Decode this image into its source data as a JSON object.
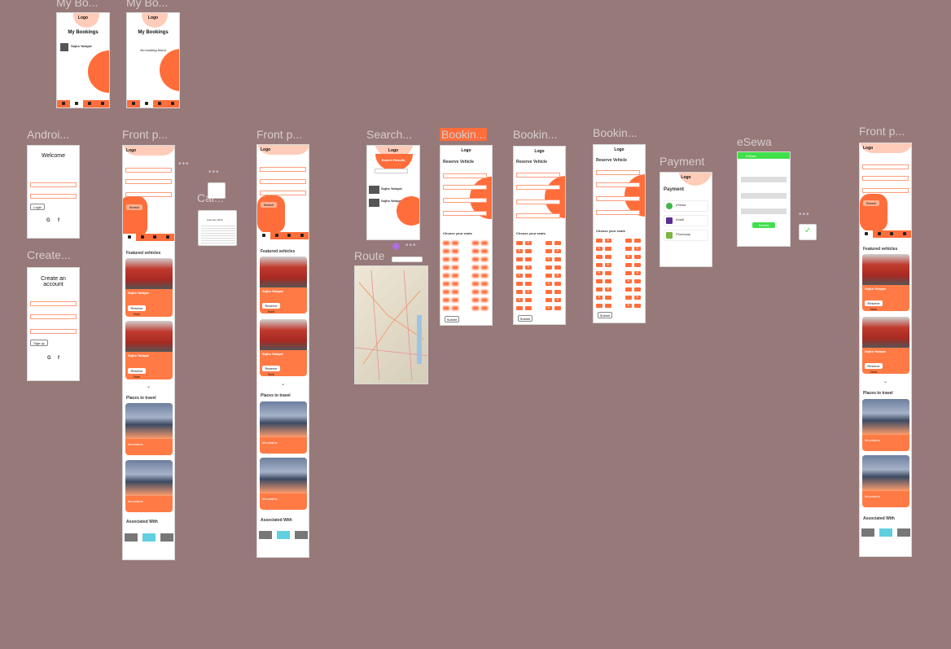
{
  "canvas": {
    "background": "#977979",
    "accent": "#ff6d3b"
  },
  "labels": {
    "my_bookings_1": "My Bo...",
    "my_bookings_2": "My Bo...",
    "android": "Androi...",
    "front_1": "Front p...",
    "front_2": "Front p...",
    "front_3": "Front p...",
    "search": "Search...",
    "booking_1": "Bookin...",
    "booking_2": "Bookin...",
    "booking_3": "Bookin...",
    "payment": "Payment",
    "esewa": "eSewa",
    "create": "Create...",
    "route": "Route",
    "cal": "Cal..."
  },
  "common": {
    "logo": "Logo",
    "featured": "Featured vehicles",
    "places": "Places to travel",
    "associated": "Associated With",
    "bus_name": "Sajha Yatayat",
    "reserve": "Reserve Now",
    "search_btn": "Search",
    "mountain": "Mountains",
    "submit": "Submit",
    "choose_seats": "Choose your seats",
    "reserve_vehicle": "Reserve Vehicle"
  },
  "my_bookings": {
    "title": "My Bookings",
    "item_name": "Sajha Yatayat",
    "empty": "No booking found"
  },
  "welcome": {
    "title": "Welcome",
    "login": "Login",
    "g": "G",
    "f": "f"
  },
  "create_account": {
    "title": "Create an account",
    "signup": "Sign up"
  },
  "search_results": {
    "title": "Search Results"
  },
  "payment": {
    "title": "Payment",
    "options": [
      "eSewa",
      "Khalti",
      "Phonepay"
    ]
  },
  "esewa": {
    "header": "eSewa",
    "button": "Submit"
  },
  "calendar": {
    "month": "February 2019"
  }
}
